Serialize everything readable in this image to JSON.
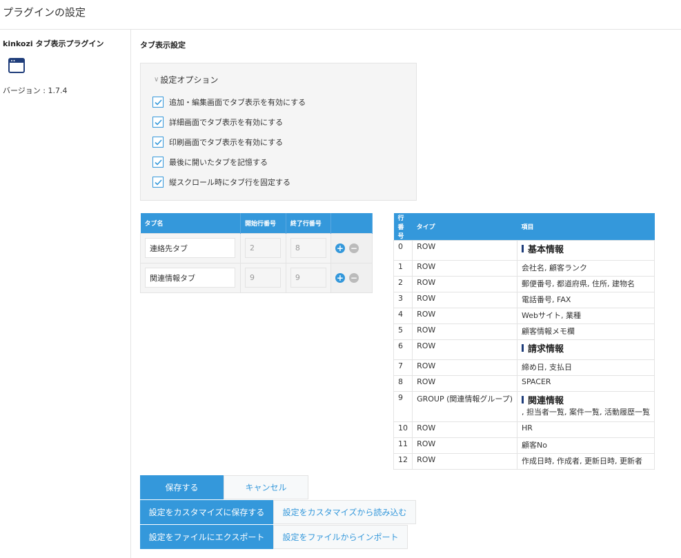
{
  "page": {
    "title": "プラグインの設定"
  },
  "sidebar": {
    "plugin_name": "kinkozi タブ表示プラグイン",
    "icon": "window-icon",
    "version": "バージョン : 1.7.4"
  },
  "section": {
    "title": "タブ表示設定"
  },
  "options": {
    "header": "設定オプション",
    "items": [
      {
        "label": "追加・編集画面でタブ表示を有効にする",
        "checked": true
      },
      {
        "label": "詳細画面でタブ表示を有効にする",
        "checked": true
      },
      {
        "label": "印刷画面でタブ表示を有効にする",
        "checked": true
      },
      {
        "label": "最後に開いたタブを記憶する",
        "checked": true
      },
      {
        "label": "縦スクロール時にタブ行を固定する",
        "checked": true
      }
    ]
  },
  "tabs_table": {
    "headers": [
      "タブ名",
      "開始行番号",
      "終了行番号"
    ],
    "rows": [
      {
        "name": "連絡先タブ",
        "start": "2",
        "end": "8"
      },
      {
        "name": "関連情報タブ",
        "start": "9",
        "end": "9"
      }
    ]
  },
  "rows_table": {
    "headers": [
      "行番号",
      "タイプ",
      "項目"
    ],
    "rows": [
      {
        "no": "0",
        "type": "ROW",
        "item": "基本情報",
        "heading": true
      },
      {
        "no": "1",
        "type": "ROW",
        "item": "会社名, 顧客ランク"
      },
      {
        "no": "2",
        "type": "ROW",
        "item": "郵便番号, 都道府県, 住所, 建物名"
      },
      {
        "no": "3",
        "type": "ROW",
        "item": "電話番号, FAX"
      },
      {
        "no": "4",
        "type": "ROW",
        "item": "Webサイト, 業種"
      },
      {
        "no": "5",
        "type": "ROW",
        "item": "顧客情報メモ欄"
      },
      {
        "no": "6",
        "type": "ROW",
        "item": "請求情報",
        "heading": true
      },
      {
        "no": "7",
        "type": "ROW",
        "item": "締め日, 支払日"
      },
      {
        "no": "8",
        "type": "ROW",
        "item": "SPACER"
      },
      {
        "no": "9",
        "type": "GROUP (関連情報グループ)",
        "item": "関連情報",
        "heading": true,
        "sub": ", 担当者一覧, 案件一覧, 活動履歴一覧"
      },
      {
        "no": "10",
        "type": "ROW",
        "item": "HR"
      },
      {
        "no": "11",
        "type": "ROW",
        "item": "顧客No"
      },
      {
        "no": "12",
        "type": "ROW",
        "item": "作成日時, 作成者, 更新日時, 更新者"
      }
    ]
  },
  "buttons": {
    "save": "保存する",
    "cancel": "キャンセル",
    "save_customize": "設定をカスタマイズに保存する",
    "load_customize": "設定をカスタマイズから読み込む",
    "export_file": "設定をファイルにエクスポート",
    "import_file": "設定をファイルからインポート"
  },
  "colors": {
    "accent": "#3498db",
    "panel_bg": "#f5f5f5",
    "border": "#e3e3e3",
    "heading_bar": "#1f3d7a"
  }
}
